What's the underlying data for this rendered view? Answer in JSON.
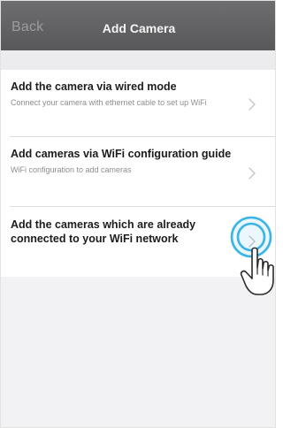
{
  "nav": {
    "back_label": "Back",
    "title": "Add Camera"
  },
  "options": [
    {
      "title": "Add the camera via wired mode",
      "description": "Connect your camera with ethernet cable to set up WiFi",
      "icon": "chevron-right-icon"
    },
    {
      "title": "Add cameras via WiFi configuration guide",
      "description": "WiFi configuration to add cameras",
      "icon": "chevron-right-icon"
    },
    {
      "title": "Add the cameras which are already connected to your WiFi network",
      "description": "",
      "icon": "chevron-right-icon"
    }
  ],
  "overlay": {
    "tap_icon": "tap-ripple-icon",
    "hand_icon": "pointing-hand-icon",
    "accent_color": "#39b4e6"
  },
  "colors": {
    "nav_background": "#5f5f61",
    "nav_title": "#f4f4f4",
    "nav_back": "#9c9c9e",
    "page_background": "#f2f2f4",
    "row_background": "#ffffff",
    "title_text": "#1c1c1c",
    "description_text": "#8e8e8e",
    "chevron": "#c4c4c4"
  }
}
